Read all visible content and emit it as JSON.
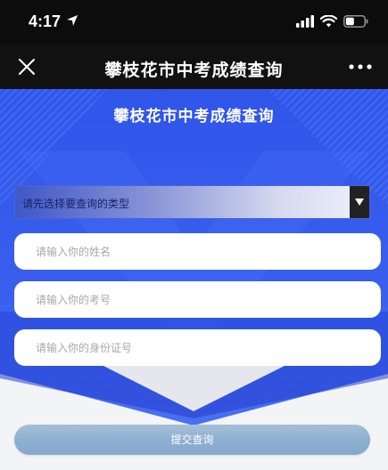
{
  "status_bar": {
    "time": "4:17"
  },
  "nav_bar": {
    "title": "攀枝花市中考成绩查询"
  },
  "hero": {
    "title": "攀枝花市中考成绩查询"
  },
  "form": {
    "type_select_label": "请先选择要查询的类型",
    "name_placeholder": "请输入你的姓名",
    "exam_number_placeholder": "请输入你的考号",
    "id_number_placeholder": "请输入你的身份证号",
    "submit_label": "提交查询"
  },
  "colors": {
    "hero_blue": "#3556e6",
    "hero_dark_blue": "#1e3ecc",
    "button_blue": "#8eafd0",
    "status_bar_bg": "#0c0c0c"
  }
}
